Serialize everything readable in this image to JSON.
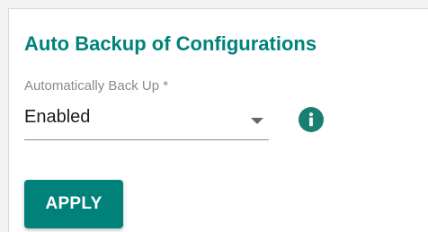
{
  "section": {
    "title": "Auto Backup of Configurations"
  },
  "auto_backup": {
    "label": "Automatically Back Up *",
    "selected_value": "Enabled",
    "dropdown_icon": "chevron-down-icon",
    "info_icon": "info-icon"
  },
  "actions": {
    "apply_label": "APPLY"
  },
  "colors": {
    "accent": "#00827a",
    "info_icon_bg": "#1a7f70",
    "label_text": "#8a8a8a",
    "underline": "#8c8c8c"
  }
}
